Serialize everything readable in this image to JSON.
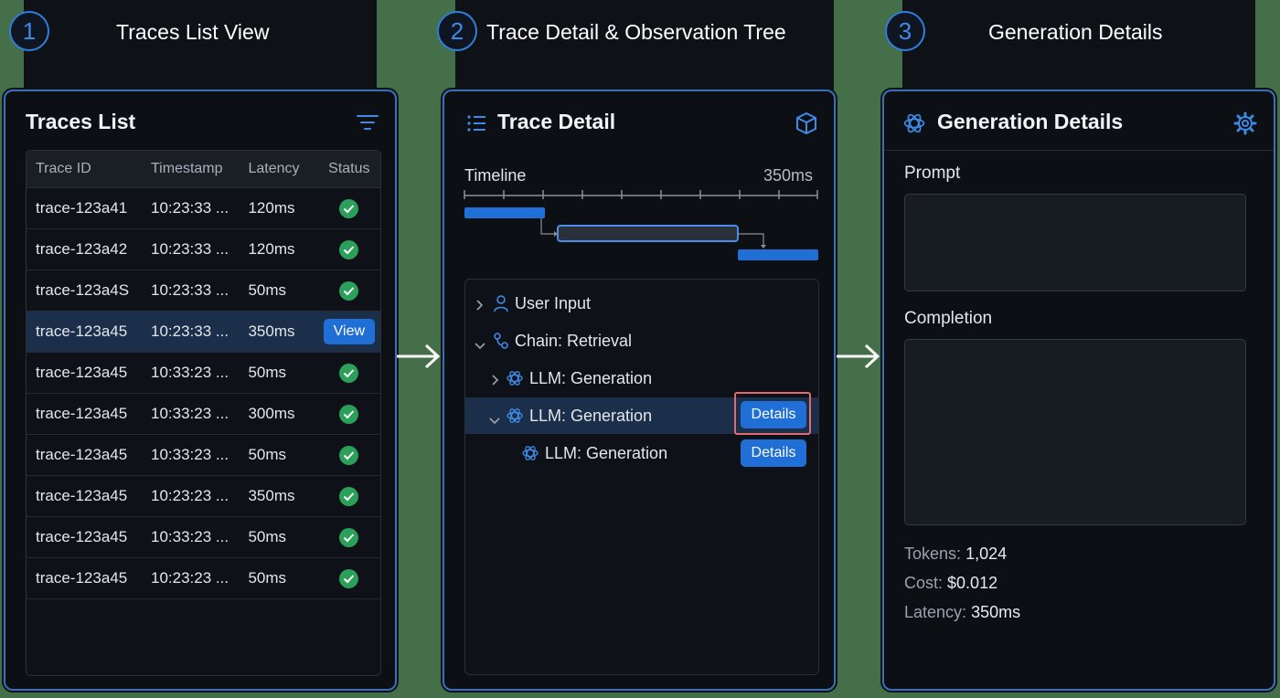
{
  "steps": [
    {
      "number": "1",
      "title": "Traces List View"
    },
    {
      "number": "2",
      "title": "Trace Detail & Observation Tree"
    },
    {
      "number": "3",
      "title": "Generation Details"
    }
  ],
  "traces_panel": {
    "title": "Traces List",
    "columns": [
      "Trace ID",
      "Timestamp",
      "Latency",
      "Status"
    ],
    "view_label": "View",
    "rows": [
      {
        "id": "trace-123a41",
        "timestamp": "10:23:33 ...",
        "latency": "120ms",
        "status": "success"
      },
      {
        "id": "trace-123a42",
        "timestamp": "10:23:33 ...",
        "latency": "120ms",
        "status": "success"
      },
      {
        "id": "trace-123a4S",
        "timestamp": "10:23:33 ...",
        "latency": "50ms",
        "status": "success"
      },
      {
        "id": "trace-123a45",
        "timestamp": "10:23:33 ...",
        "latency": "350ms",
        "status": "view"
      },
      {
        "id": "trace-123a45",
        "timestamp": "10:33:23 ...",
        "latency": "50ms",
        "status": "success"
      },
      {
        "id": "trace-123a45",
        "timestamp": "10:33:23 ...",
        "latency": "300ms",
        "status": "success"
      },
      {
        "id": "trace-123a45",
        "timestamp": "10:33:23 ...",
        "latency": "50ms",
        "status": "success"
      },
      {
        "id": "trace-123a45",
        "timestamp": "10:23:23 ...",
        "latency": "350ms",
        "status": "success"
      },
      {
        "id": "trace-123a45",
        "timestamp": "10:33:23 ...",
        "latency": "50ms",
        "status": "success"
      },
      {
        "id": "trace-123a45",
        "timestamp": "10:23:23 ...",
        "latency": "50ms",
        "status": "success"
      }
    ]
  },
  "trace_detail": {
    "title": "Trace Detail",
    "timeline_label": "Timeline",
    "timeline_total": "350ms",
    "tree": [
      {
        "label": "User Input",
        "expand": "collapsed",
        "icon": "user-icon"
      },
      {
        "label": "Chain: Retrieval",
        "expand": "expanded",
        "icon": "chain-icon"
      },
      {
        "label": "LLM: Generation",
        "expand": "collapsed",
        "icon": "openai-icon"
      },
      {
        "label": "LLM: Generation",
        "expand": "expanded",
        "icon": "openai-icon",
        "button": "Details"
      },
      {
        "label": "LLM: Generation",
        "icon": "openai-icon",
        "button": "Details"
      }
    ]
  },
  "generation": {
    "title": "Generation Details",
    "prompt_label": "Prompt",
    "completion_label": "Completion",
    "tokens_label": "Tokens:",
    "tokens_value": "1,024",
    "cost_label": "Cost:",
    "cost_value": "$0.012",
    "latency_label": "Latency:",
    "latency_value": "350ms"
  },
  "colors": {
    "accent": "#1f6fd6",
    "success": "#2aa05a",
    "highlight": "#e06c6c"
  }
}
